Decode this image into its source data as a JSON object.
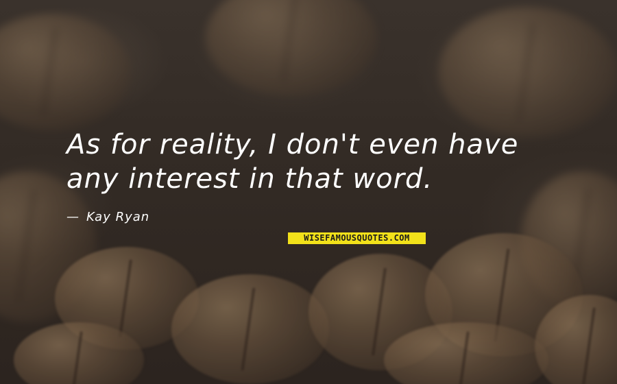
{
  "quote": {
    "text": "As for reality, I don't even have\nany interest in that word.",
    "author": "Kay Ryan",
    "author_prefix": "—"
  },
  "watermark": {
    "text": "WISEFAMOUSQUOTES.COM",
    "background_color": "#f2e11a"
  },
  "colors": {
    "text": "#ffffff",
    "background": "#2a2420"
  }
}
